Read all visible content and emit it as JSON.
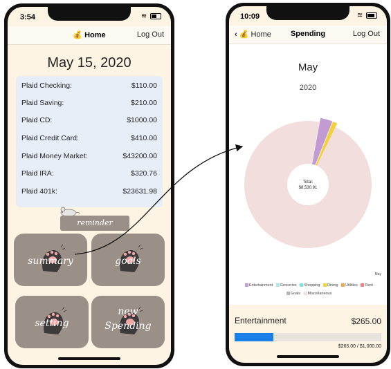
{
  "left_screen": {
    "status_time": "3:54",
    "nav_title": "Home",
    "logout_label": "Log Out",
    "date": "May 15, 2020",
    "accounts": [
      {
        "name": "Plaid Checking:",
        "amount": "$110.00"
      },
      {
        "name": "Plaid Saving:",
        "amount": "$210.00"
      },
      {
        "name": "Plaid CD:",
        "amount": "$1000.00"
      },
      {
        "name": "Plaid Credit Card:",
        "amount": "$410.00"
      },
      {
        "name": "Plaid Money Market:",
        "amount": "$43200.00"
      },
      {
        "name": "Plaid IRA:",
        "amount": "$320.76"
      },
      {
        "name": "Plaid 401k:",
        "amount": "$23631.98"
      }
    ],
    "reminder_label": "reminder",
    "tiles": {
      "summary": "summary",
      "goals": "goals",
      "setting": "setting",
      "new_spending_1": "new",
      "new_spending_2": "Spending"
    }
  },
  "right_screen": {
    "status_time": "10:09",
    "back_label": "Home",
    "nav_title": "Spending",
    "logout_label": "Log Out",
    "month": "May",
    "year": "2020",
    "total_label": "Total:",
    "total_value": "$8,530.91",
    "corner_label": "May",
    "legend": [
      {
        "name": "Entertainment",
        "color": "#c39bd3"
      },
      {
        "name": "Groceries",
        "color": "#aee6ee"
      },
      {
        "name": "Shopping",
        "color": "#7fdfe8"
      },
      {
        "name": "Dining",
        "color": "#f4d03f"
      },
      {
        "name": "Utilities",
        "color": "#f0a64a"
      },
      {
        "name": "Rent",
        "color": "#f08080"
      },
      {
        "name": "Goals",
        "color": "#b7b7b7"
      },
      {
        "name": "Miscellaneous",
        "color": "#f3dede"
      }
    ],
    "category": "Entertainment",
    "category_amount": "$265.00",
    "progress_text": "$265.00 / $1,000.00",
    "progress": 0.265
  },
  "chart_data": {
    "type": "pie",
    "categories": [
      "Entertainment",
      "Dining",
      "Miscellaneous"
    ],
    "values": [
      265,
      100,
      8165.91
    ],
    "total": 8530.91
  },
  "icons": {
    "home": "money-bag-icon",
    "back": "chevron-left-icon",
    "wifi": "wifi-icon",
    "battery": "battery-icon"
  }
}
